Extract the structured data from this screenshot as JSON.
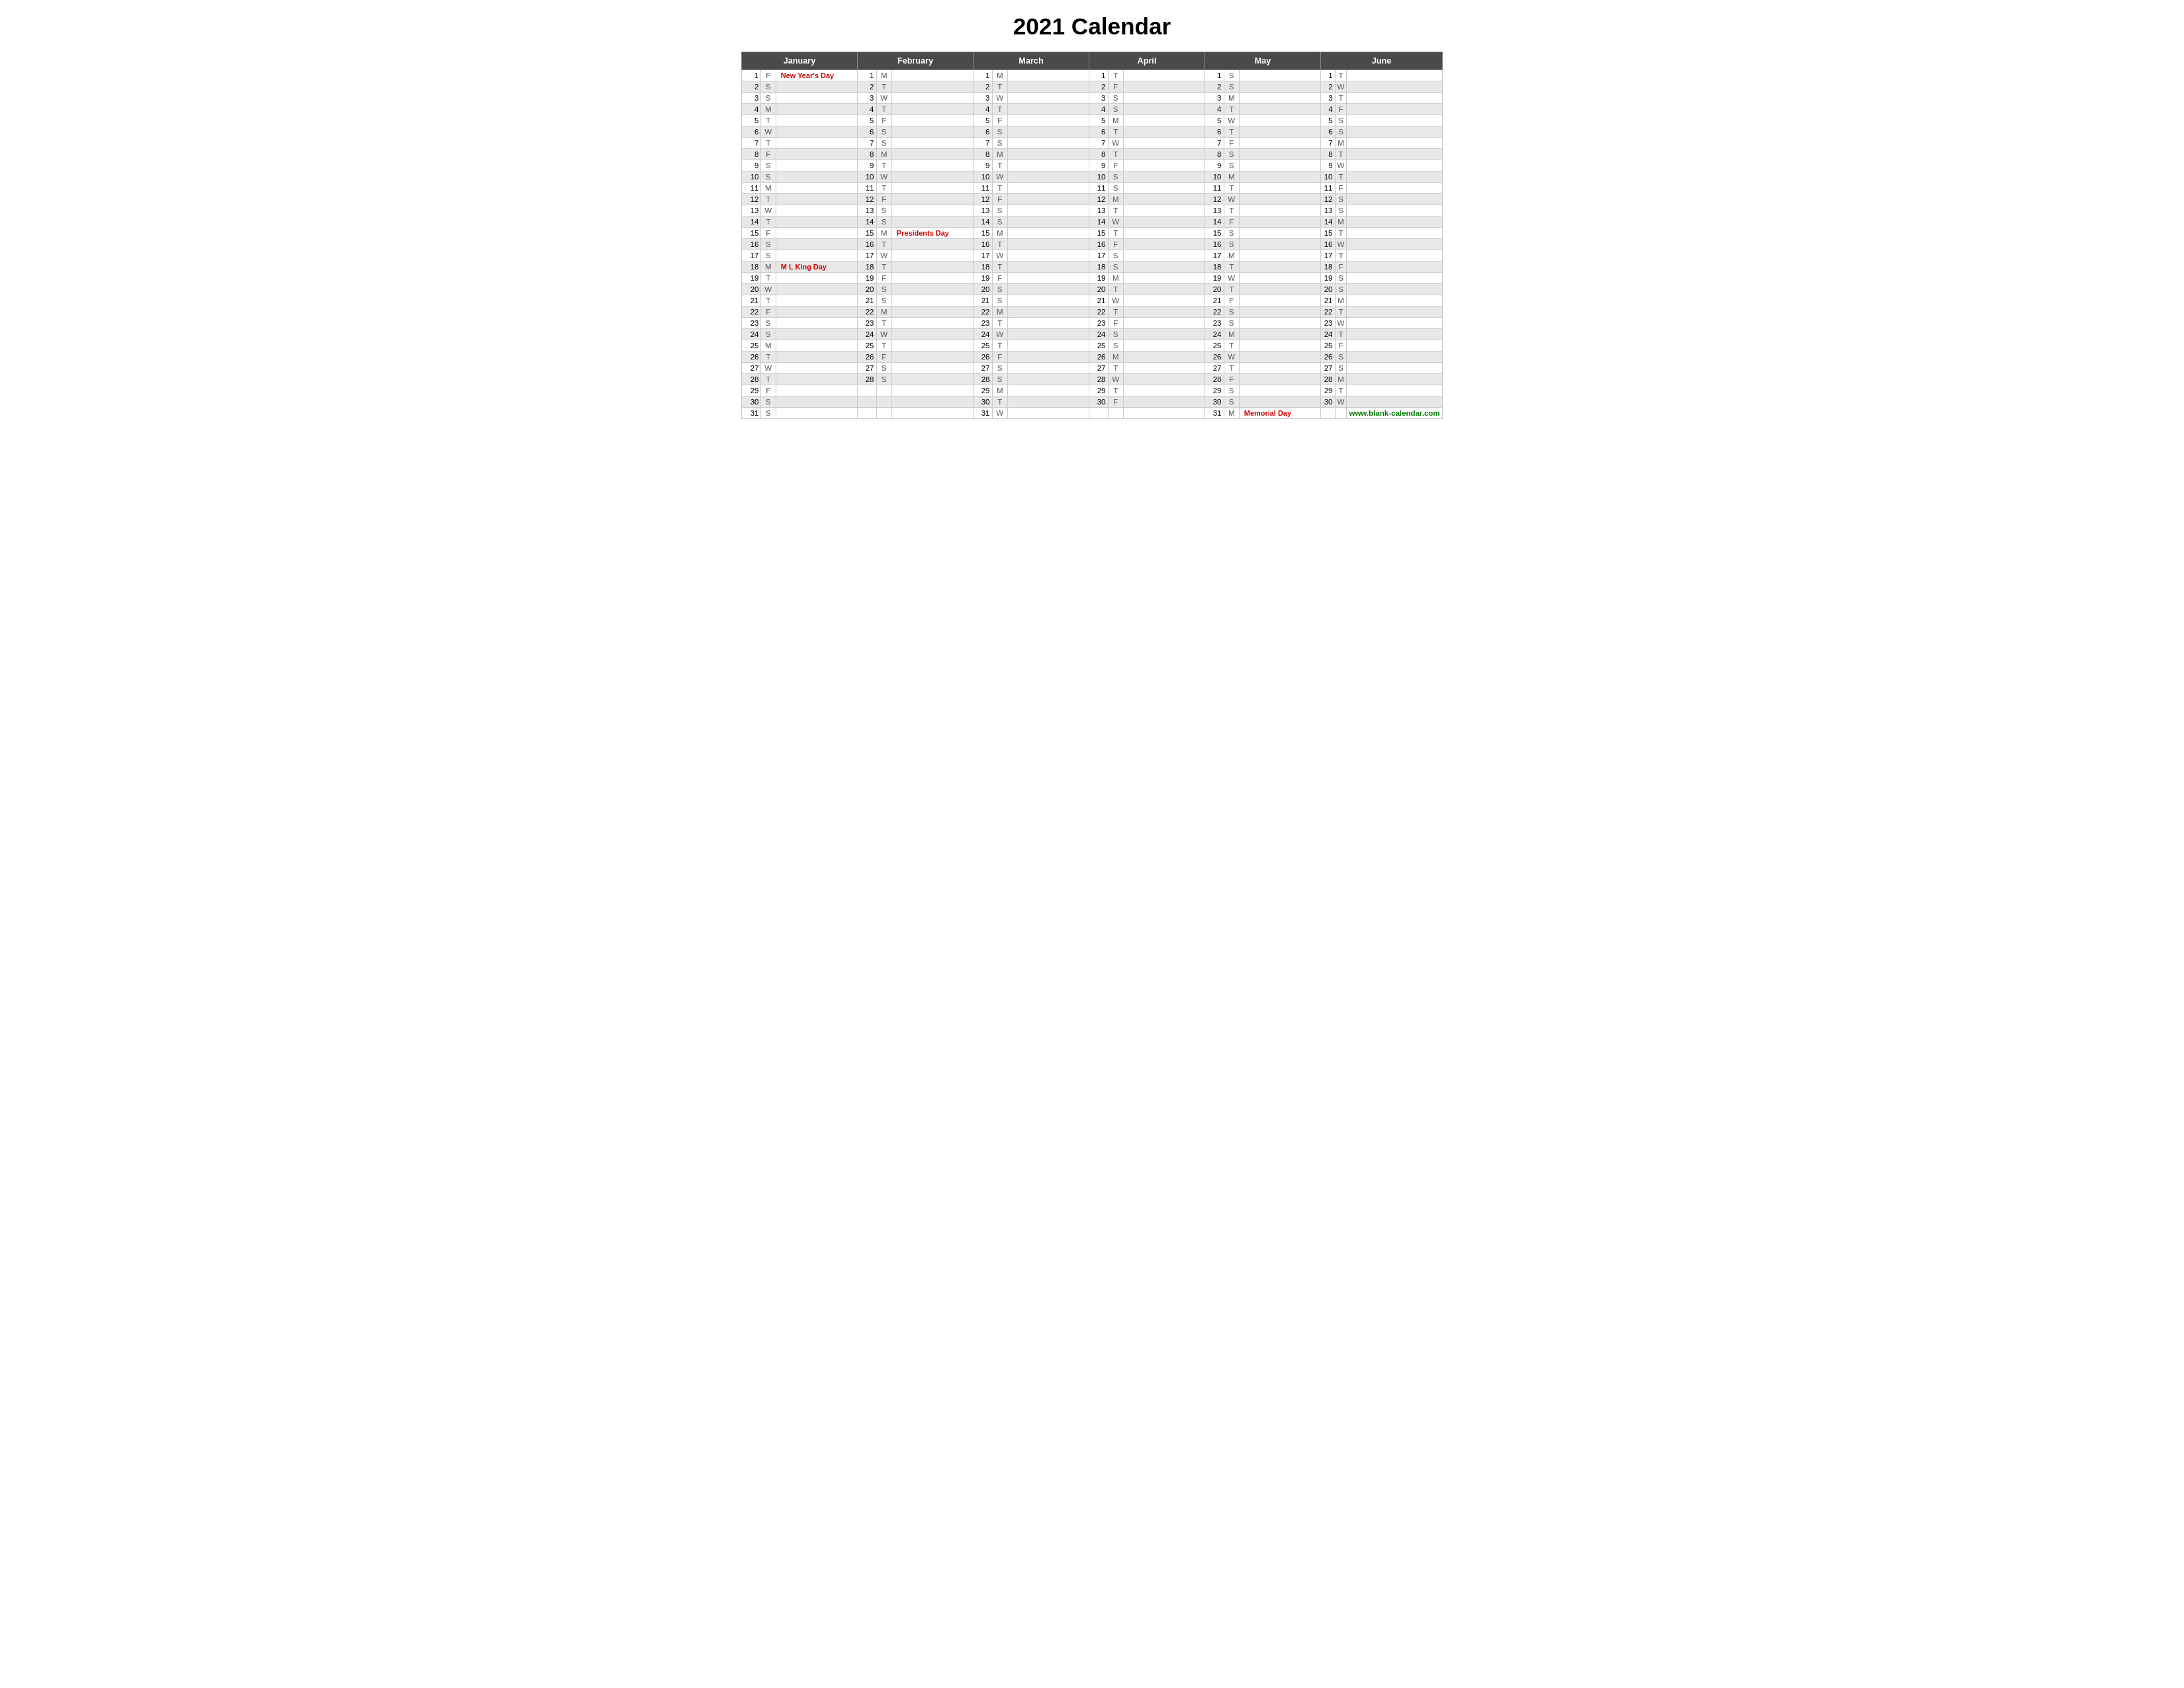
{
  "title": "2021 Calendar",
  "months": [
    "January",
    "February",
    "March",
    "April",
    "May",
    "June"
  ],
  "website": "www.blank-calendar.com",
  "rows": [
    {
      "num": 1,
      "jan_d": "F",
      "jan_h": "New Year's Day",
      "feb_d": "M",
      "feb_h": "",
      "mar_d": "M",
      "mar_h": "",
      "apr_d": "T",
      "apr_h": "",
      "may_d": "S",
      "may_h": "",
      "jun_d": "T",
      "jun_h": "",
      "shade": false
    },
    {
      "num": 2,
      "jan_d": "S",
      "jan_h": "",
      "feb_d": "T",
      "feb_h": "",
      "mar_d": "T",
      "mar_h": "",
      "apr_d": "F",
      "apr_h": "",
      "may_d": "S",
      "may_h": "",
      "jun_d": "W",
      "jun_h": "",
      "shade": true
    },
    {
      "num": 3,
      "jan_d": "S",
      "jan_h": "",
      "feb_d": "W",
      "feb_h": "",
      "mar_d": "W",
      "mar_h": "",
      "apr_d": "S",
      "apr_h": "",
      "may_d": "M",
      "may_h": "",
      "jun_d": "T",
      "jun_h": "",
      "shade": false
    },
    {
      "num": 4,
      "jan_d": "M",
      "jan_h": "",
      "feb_d": "T",
      "feb_h": "",
      "mar_d": "T",
      "mar_h": "",
      "apr_d": "S",
      "apr_h": "",
      "may_d": "T",
      "may_h": "",
      "jun_d": "F",
      "jun_h": "",
      "shade": true
    },
    {
      "num": 5,
      "jan_d": "T",
      "jan_h": "",
      "feb_d": "F",
      "feb_h": "",
      "mar_d": "F",
      "mar_h": "",
      "apr_d": "M",
      "apr_h": "",
      "may_d": "W",
      "may_h": "",
      "jun_d": "S",
      "jun_h": "",
      "shade": false
    },
    {
      "num": 6,
      "jan_d": "W",
      "jan_h": "",
      "feb_d": "S",
      "feb_h": "",
      "mar_d": "S",
      "mar_h": "",
      "apr_d": "T",
      "apr_h": "",
      "may_d": "T",
      "may_h": "",
      "jun_d": "S",
      "jun_h": "",
      "shade": true
    },
    {
      "num": 7,
      "jan_d": "T",
      "jan_h": "",
      "feb_d": "S",
      "feb_h": "",
      "mar_d": "S",
      "mar_h": "",
      "apr_d": "W",
      "apr_h": "",
      "may_d": "F",
      "may_h": "",
      "jun_d": "M",
      "jun_h": "",
      "shade": false
    },
    {
      "num": 8,
      "jan_d": "F",
      "jan_h": "",
      "feb_d": "M",
      "feb_h": "",
      "mar_d": "M",
      "mar_h": "",
      "apr_d": "T",
      "apr_h": "",
      "may_d": "S",
      "may_h": "",
      "jun_d": "T",
      "jun_h": "",
      "shade": true
    },
    {
      "num": 9,
      "jan_d": "S",
      "jan_h": "",
      "feb_d": "T",
      "feb_h": "",
      "mar_d": "T",
      "mar_h": "",
      "apr_d": "F",
      "apr_h": "",
      "may_d": "S",
      "may_h": "",
      "jun_d": "W",
      "jun_h": "",
      "shade": false
    },
    {
      "num": 10,
      "jan_d": "S",
      "jan_h": "",
      "feb_d": "W",
      "feb_h": "",
      "mar_d": "W",
      "mar_h": "",
      "apr_d": "S",
      "apr_h": "",
      "may_d": "M",
      "may_h": "",
      "jun_d": "T",
      "jun_h": "",
      "shade": true
    },
    {
      "num": 11,
      "jan_d": "M",
      "jan_h": "",
      "feb_d": "T",
      "feb_h": "",
      "mar_d": "T",
      "mar_h": "",
      "apr_d": "S",
      "apr_h": "",
      "may_d": "T",
      "may_h": "",
      "jun_d": "F",
      "jun_h": "",
      "shade": false
    },
    {
      "num": 12,
      "jan_d": "T",
      "jan_h": "",
      "feb_d": "F",
      "feb_h": "",
      "mar_d": "F",
      "mar_h": "",
      "apr_d": "M",
      "apr_h": "",
      "may_d": "W",
      "may_h": "",
      "jun_d": "S",
      "jun_h": "",
      "shade": true
    },
    {
      "num": 13,
      "jan_d": "W",
      "jan_h": "",
      "feb_d": "S",
      "feb_h": "",
      "mar_d": "S",
      "mar_h": "",
      "apr_d": "T",
      "apr_h": "",
      "may_d": "T",
      "may_h": "",
      "jun_d": "S",
      "jun_h": "",
      "shade": false
    },
    {
      "num": 14,
      "jan_d": "T",
      "jan_h": "",
      "feb_d": "S",
      "feb_h": "",
      "mar_d": "S",
      "mar_h": "",
      "apr_d": "W",
      "apr_h": "",
      "may_d": "F",
      "may_h": "",
      "jun_d": "M",
      "jun_h": "",
      "shade": true
    },
    {
      "num": 15,
      "jan_d": "F",
      "jan_h": "",
      "feb_d": "M",
      "feb_h": "Presidents Day",
      "mar_d": "M",
      "mar_h": "",
      "apr_d": "T",
      "apr_h": "",
      "may_d": "S",
      "may_h": "",
      "jun_d": "T",
      "jun_h": "",
      "shade": false
    },
    {
      "num": 16,
      "jan_d": "S",
      "jan_h": "",
      "feb_d": "T",
      "feb_h": "",
      "mar_d": "T",
      "mar_h": "",
      "apr_d": "F",
      "apr_h": "",
      "may_d": "S",
      "may_h": "",
      "jun_d": "W",
      "jun_h": "",
      "shade": true
    },
    {
      "num": 17,
      "jan_d": "S",
      "jan_h": "",
      "feb_d": "W",
      "feb_h": "",
      "mar_d": "W",
      "mar_h": "",
      "apr_d": "S",
      "apr_h": "",
      "may_d": "M",
      "may_h": "",
      "jun_d": "T",
      "jun_h": "",
      "shade": false
    },
    {
      "num": 18,
      "jan_d": "M",
      "jan_h": "M L King Day",
      "feb_d": "T",
      "feb_h": "",
      "mar_d": "T",
      "mar_h": "",
      "apr_d": "S",
      "apr_h": "",
      "may_d": "T",
      "may_h": "",
      "jun_d": "F",
      "jun_h": "",
      "shade": true
    },
    {
      "num": 19,
      "jan_d": "T",
      "jan_h": "",
      "feb_d": "F",
      "feb_h": "",
      "mar_d": "F",
      "mar_h": "",
      "apr_d": "M",
      "apr_h": "",
      "may_d": "W",
      "may_h": "",
      "jun_d": "S",
      "jun_h": "",
      "shade": false
    },
    {
      "num": 20,
      "jan_d": "W",
      "jan_h": "",
      "feb_d": "S",
      "feb_h": "",
      "mar_d": "S",
      "mar_h": "",
      "apr_d": "T",
      "apr_h": "",
      "may_d": "T",
      "may_h": "",
      "jun_d": "S",
      "jun_h": "",
      "shade": true
    },
    {
      "num": 21,
      "jan_d": "T",
      "jan_h": "",
      "feb_d": "S",
      "feb_h": "",
      "mar_d": "S",
      "mar_h": "",
      "apr_d": "W",
      "apr_h": "",
      "may_d": "F",
      "may_h": "",
      "jun_d": "M",
      "jun_h": "",
      "shade": false
    },
    {
      "num": 22,
      "jan_d": "F",
      "jan_h": "",
      "feb_d": "M",
      "feb_h": "",
      "mar_d": "M",
      "mar_h": "",
      "apr_d": "T",
      "apr_h": "",
      "may_d": "S",
      "may_h": "",
      "jun_d": "T",
      "jun_h": "",
      "shade": true
    },
    {
      "num": 23,
      "jan_d": "S",
      "jan_h": "",
      "feb_d": "T",
      "feb_h": "",
      "mar_d": "T",
      "mar_h": "",
      "apr_d": "F",
      "apr_h": "",
      "may_d": "S",
      "may_h": "",
      "jun_d": "W",
      "jun_h": "",
      "shade": false
    },
    {
      "num": 24,
      "jan_d": "S",
      "jan_h": "",
      "feb_d": "W",
      "feb_h": "",
      "mar_d": "W",
      "mar_h": "",
      "apr_d": "S",
      "apr_h": "",
      "may_d": "M",
      "may_h": "",
      "jun_d": "T",
      "jun_h": "",
      "shade": true
    },
    {
      "num": 25,
      "jan_d": "M",
      "jan_h": "",
      "feb_d": "T",
      "feb_h": "",
      "mar_d": "T",
      "mar_h": "",
      "apr_d": "S",
      "apr_h": "",
      "may_d": "T",
      "may_h": "",
      "jun_d": "F",
      "jun_h": "",
      "shade": false
    },
    {
      "num": 26,
      "jan_d": "T",
      "jan_h": "",
      "feb_d": "F",
      "feb_h": "",
      "mar_d": "F",
      "mar_h": "",
      "apr_d": "M",
      "apr_h": "",
      "may_d": "W",
      "may_h": "",
      "jun_d": "S",
      "jun_h": "",
      "shade": true
    },
    {
      "num": 27,
      "jan_d": "W",
      "jan_h": "",
      "feb_d": "S",
      "feb_h": "",
      "mar_d": "S",
      "mar_h": "",
      "apr_d": "T",
      "apr_h": "",
      "may_d": "T",
      "may_h": "",
      "jun_d": "S",
      "jun_h": "",
      "shade": false
    },
    {
      "num": 28,
      "jan_d": "T",
      "jan_h": "",
      "feb_d": "S",
      "feb_h": "",
      "mar_d": "S",
      "mar_h": "",
      "apr_d": "W",
      "apr_h": "",
      "may_d": "F",
      "may_h": "",
      "jun_d": "M",
      "jun_h": "",
      "shade": true
    },
    {
      "num": 29,
      "jan_d": "F",
      "jan_h": "",
      "feb_d": "",
      "feb_h": "",
      "mar_d": "M",
      "mar_h": "",
      "apr_d": "T",
      "apr_h": "",
      "may_d": "S",
      "may_h": "",
      "jun_d": "T",
      "jun_h": "",
      "shade": false
    },
    {
      "num": 30,
      "jan_d": "S",
      "jan_h": "",
      "feb_d": "",
      "feb_h": "",
      "mar_d": "T",
      "mar_h": "",
      "apr_d": "F",
      "apr_h": "",
      "may_d": "S",
      "may_h": "",
      "jun_d": "W",
      "jun_h": "",
      "shade": true
    },
    {
      "num": 31,
      "jan_d": "S",
      "jan_h": "",
      "feb_d": "",
      "feb_h": "",
      "mar_d": "W",
      "mar_h": "",
      "apr_d": "",
      "apr_h": "",
      "may_d": "M",
      "may_h": "Memorial Day",
      "jun_d": "",
      "jun_h": "",
      "shade": false
    }
  ]
}
